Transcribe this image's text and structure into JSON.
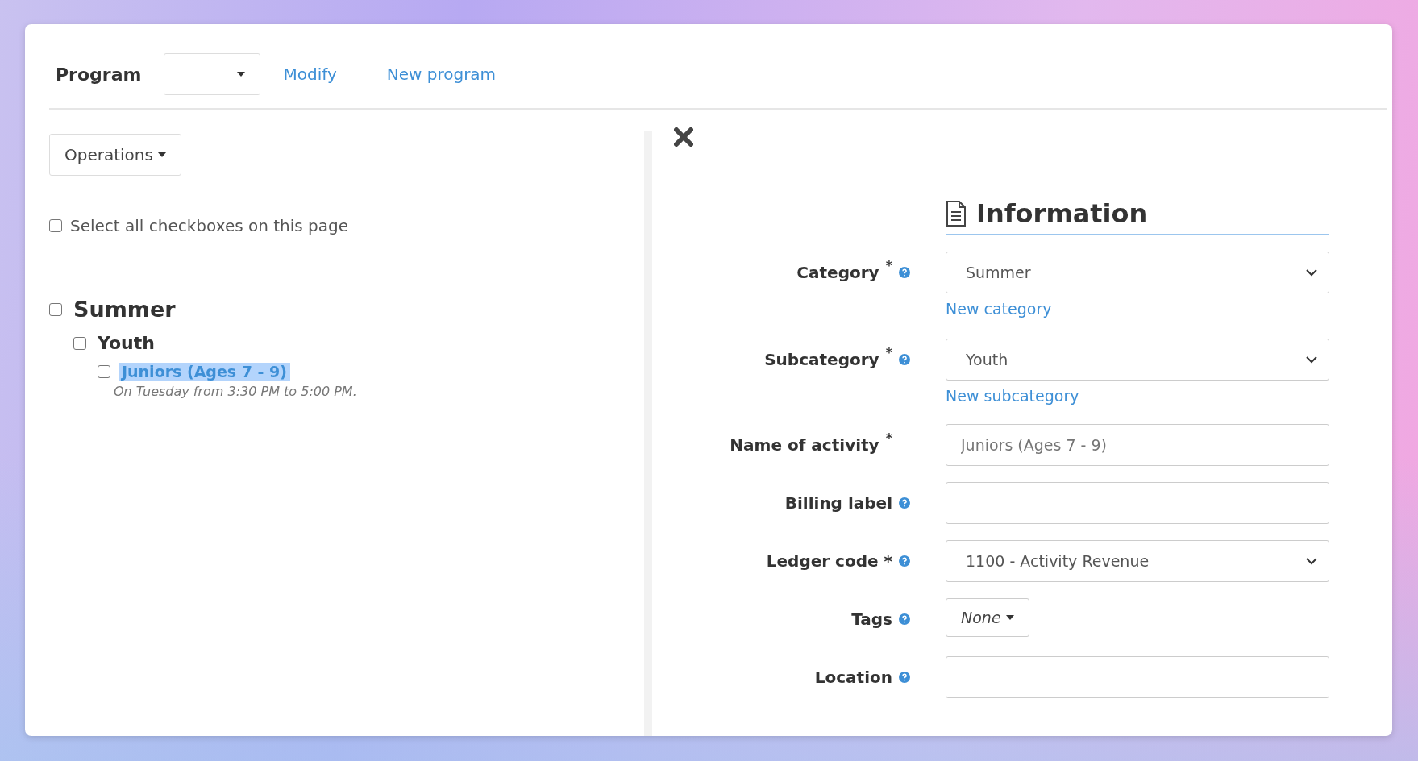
{
  "header": {
    "label": "Program",
    "links": [
      "Modify",
      "New program"
    ]
  },
  "operations": {
    "label": "Operations"
  },
  "select_all": {
    "label": "Select all checkboxes on this page",
    "checked": false
  },
  "tree": [
    {
      "label": "Summer",
      "checked": false,
      "children": [
        {
          "label": "Youth",
          "checked": false,
          "children": [
            {
              "label": "Juniors (Ages 7 - 9)",
              "checked": false,
              "highlighted": true,
              "note": "On Tuesday from 3:30 PM to 5:00 PM."
            }
          ]
        }
      ]
    }
  ],
  "form": {
    "title": "Information",
    "fields": [
      {
        "kind": "select",
        "label": "Category",
        "mark": "*",
        "help": true,
        "value": "Summer",
        "link": "New category"
      },
      {
        "kind": "select",
        "label": "Subcategory",
        "mark": "*",
        "help": true,
        "value": "Youth",
        "link": "New subcategory"
      },
      {
        "kind": "input",
        "label": "Name of activity",
        "mark": "*",
        "help": false,
        "placeholder": "Juniors (Ages 7 - 9)"
      },
      {
        "kind": "input",
        "label": "Billing label",
        "help": true
      },
      {
        "kind": "select",
        "label": "Ledger code *",
        "help": true,
        "value": "1100 - Activity Revenue"
      },
      {
        "kind": "tags",
        "label": "Tags",
        "help": true,
        "value": "None"
      },
      {
        "kind": "input",
        "label": "Location",
        "help": true
      }
    ]
  }
}
